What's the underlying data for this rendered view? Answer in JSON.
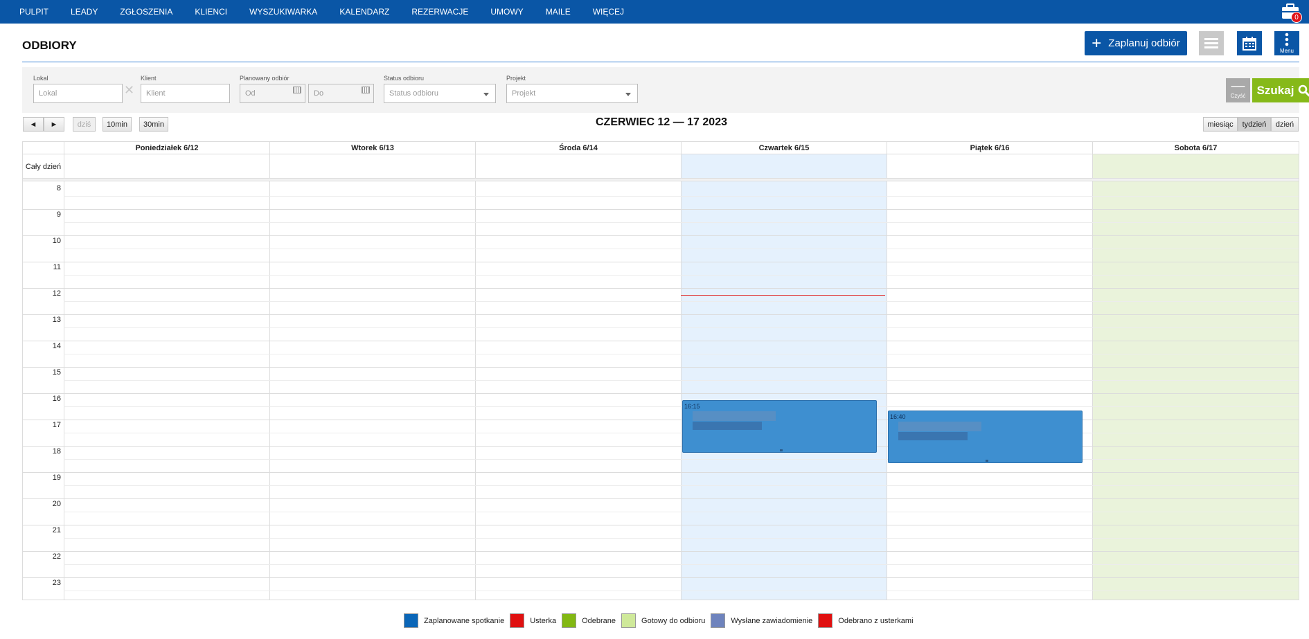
{
  "nav": {
    "items": [
      "PULPIT",
      "LEADY",
      "ZGŁOSZENIA",
      "KLIENCI",
      "WYSZUKIWARKA",
      "KALENDARZ",
      "REZERWACJE",
      "UMOWY",
      "MAILE",
      "WIĘCEJ"
    ],
    "badge_count": "0"
  },
  "header": {
    "title": "ODBIORY",
    "new_button": "Zaplanuj odbiór",
    "menu_label": "Menu"
  },
  "filters": {
    "lokal": {
      "label": "Lokal",
      "placeholder": "Lokal"
    },
    "klient": {
      "label": "Klient",
      "placeholder": "Klient"
    },
    "planowany": {
      "label": "Planowany odbiór",
      "from_placeholder": "Od",
      "to_placeholder": "Do"
    },
    "status": {
      "label": "Status odbioru",
      "value": "Status odbioru"
    },
    "projekt": {
      "label": "Projekt",
      "value": "Projekt"
    },
    "clear_label": "Czyść",
    "search_label": "Szukaj"
  },
  "toolbar": {
    "prev": "◄",
    "next": "►",
    "today": "dziś",
    "slot10": "10min",
    "slot30": "30min",
    "week_title": "CZERWIEC 12 — 17 2023",
    "view_month": "miesiąc",
    "view_week": "tydzień",
    "view_day": "dzień"
  },
  "calendar": {
    "all_day_label": "Cały dzień",
    "days": [
      "Poniedziałek 6/12",
      "Wtorek 6/13",
      "Środa 6/14",
      "Czwartek 6/15",
      "Piątek 6/16",
      "Sobota 6/17"
    ],
    "hours": [
      "8",
      "9",
      "10",
      "11",
      "12",
      "13",
      "14",
      "15",
      "16",
      "17",
      "18",
      "19",
      "20",
      "21",
      "22",
      "23"
    ],
    "today_index": 3,
    "now_time": "12:15",
    "events": [
      {
        "day_index": 3,
        "start": "16:15",
        "end": "18:15",
        "time_label": "16:15",
        "status": "Zaplanowane spotkanie"
      },
      {
        "day_index": 4,
        "start": "16:40",
        "end": "18:40",
        "time_label": "16:40",
        "status": "Zaplanowane spotkanie"
      }
    ]
  },
  "legend": [
    {
      "label": "Zaplanowane spotkanie",
      "color": "#0a66b8"
    },
    {
      "label": "Usterka",
      "color": "#e01010"
    },
    {
      "label": "Odebrane",
      "color": "#82b812"
    },
    {
      "label": "Gotowy do odbioru",
      "color": "#cfe99a"
    },
    {
      "label": "Wysłane zawiadomienie",
      "color": "#6e83bd"
    },
    {
      "label": "Odebrano z usterkami",
      "color": "#e01010"
    }
  ]
}
